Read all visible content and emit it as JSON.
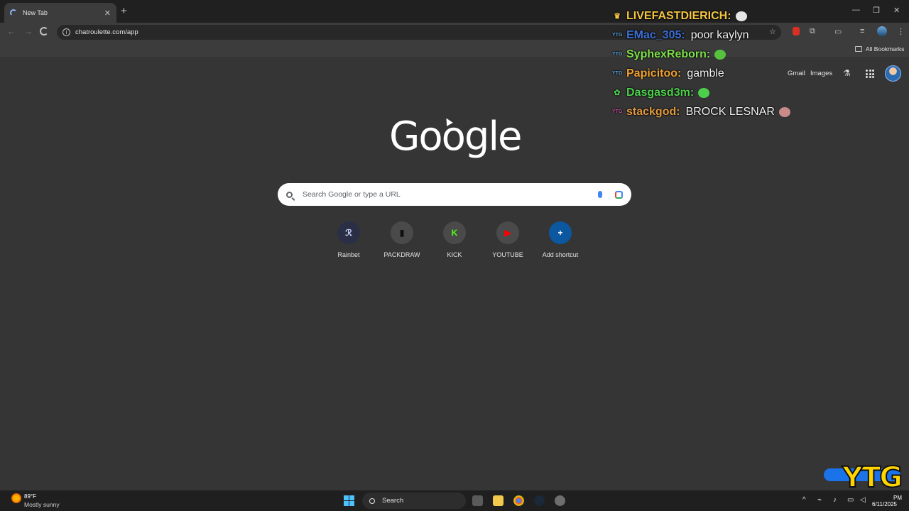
{
  "browser": {
    "tab_title": "New Tab",
    "tab_close": "✕",
    "new_tab": "+",
    "url": "chatroulette.com/app",
    "window_controls": {
      "minimize": "—",
      "restore": "❐",
      "close": "✕"
    },
    "all_bookmarks": "All Bookmarks"
  },
  "ntp": {
    "gmail": "Gmail",
    "images": "Images",
    "logo": "Google",
    "search_placeholder": "Search Google or type a URL",
    "shortcuts": [
      {
        "label": "Rainbet",
        "glyph": "ℛ",
        "bg": "#2a2f45",
        "fg": "#cfd6ff"
      },
      {
        "label": "PACKDRAW",
        "glyph": "▮",
        "bg": "#4a4a4a",
        "fg": "#111111"
      },
      {
        "label": "KICK",
        "glyph": "K",
        "bg": "#4a4a4a",
        "fg": "#53fc18"
      },
      {
        "label": "YOUTUBE",
        "glyph": "▶",
        "bg": "#4a4a4a",
        "fg": "#ff0000"
      },
      {
        "label": "Add shortcut",
        "glyph": "+",
        "bg": "#0b57a0",
        "fg": "#ffffff"
      }
    ]
  },
  "chat": [
    {
      "user": "LIVEFASTDIERICH:",
      "color": "#f5c542",
      "badge": "♛",
      "badge_color": "#f5c542",
      "msg": "",
      "emote": "#e6e6e6"
    },
    {
      "user": "EMac_305:",
      "color": "#3b6fd4",
      "badge": "YTG",
      "badge_color": "#5aa0d0",
      "msg": "poor kaylyn",
      "emote": ""
    },
    {
      "user": "SyphexReborn:",
      "color": "#7ee04a",
      "badge": "YTG",
      "badge_color": "#5aa0d0",
      "msg": "",
      "emote": "#56c23d"
    },
    {
      "user": "Papicitoo:",
      "color": "#f0a030",
      "badge": "YTG",
      "badge_color": "#5aa0d0",
      "msg": "gamble",
      "emote": ""
    },
    {
      "user": "Dasgasd3m:",
      "color": "#4cd04c",
      "badge": "✿",
      "badge_color": "#4cd04c",
      "msg": "",
      "emote": "#4cd04c"
    },
    {
      "user": "stackgod:",
      "color": "#e09a40",
      "badge": "YTG",
      "badge_color": "#c050a0",
      "msg": "BROCK LESNAR",
      "emote": "#c98a8a"
    }
  ],
  "taskbar": {
    "temperature": "89°F",
    "condition": "Mostly sunny",
    "search": "Search",
    "time": "PM",
    "date": "6/11/2025"
  },
  "watermark": "YTG"
}
